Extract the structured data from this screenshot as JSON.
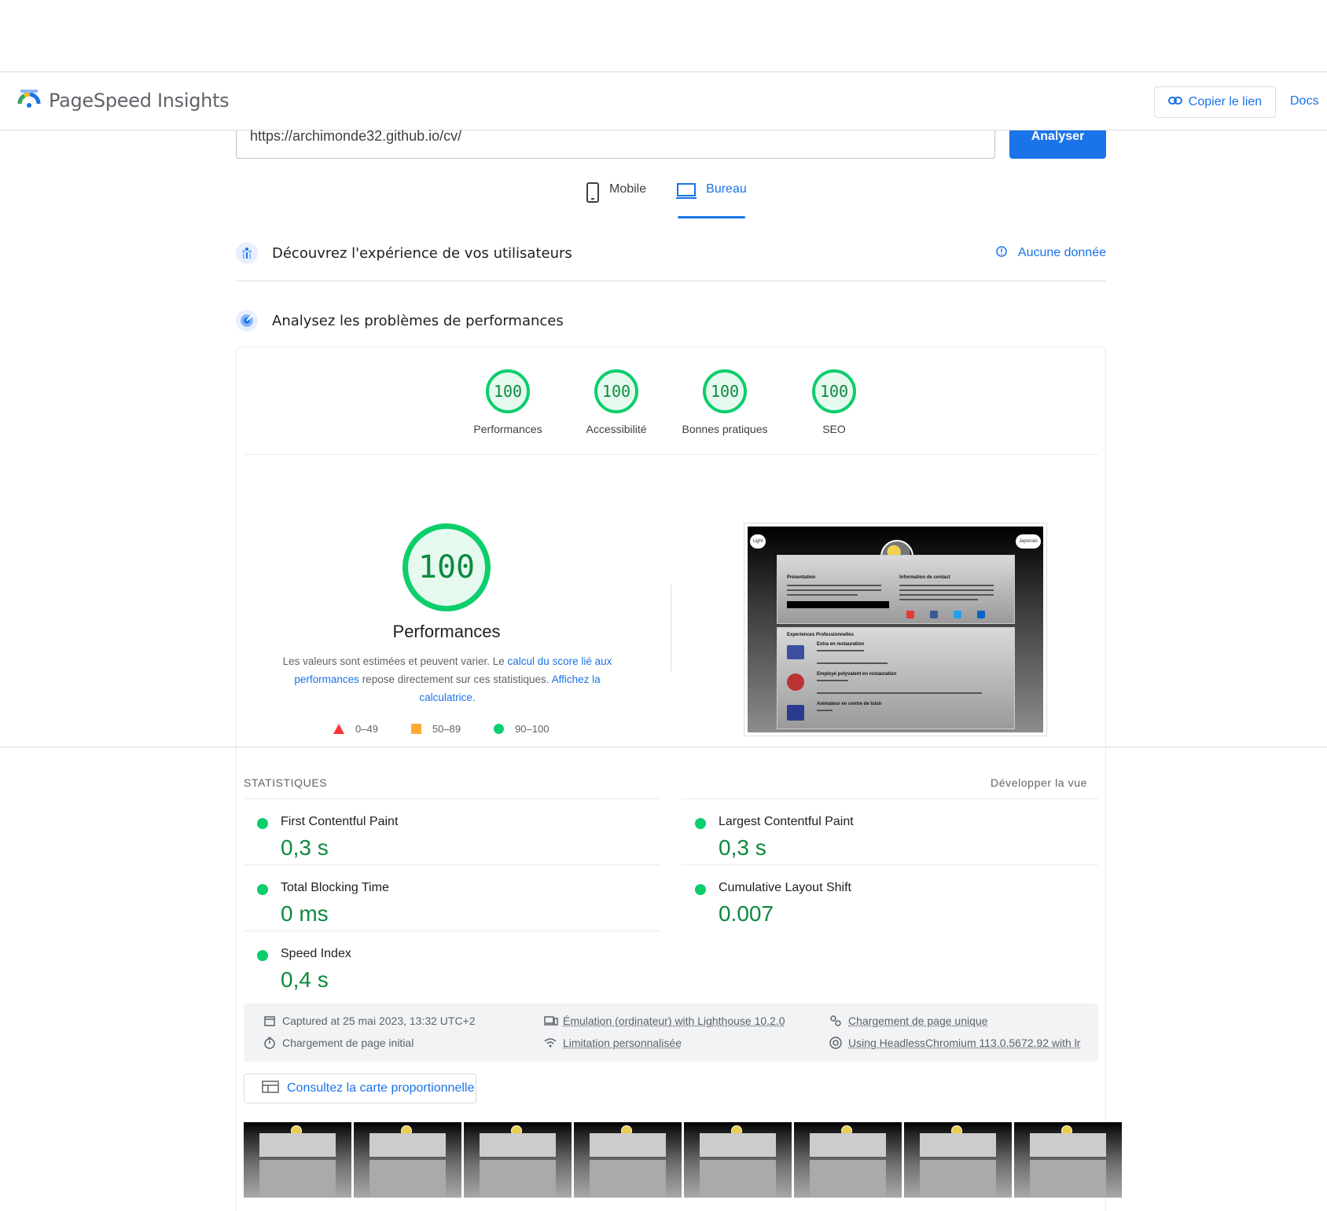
{
  "app": {
    "title": "PageSpeed Insights",
    "copy_link": "Copier le lien",
    "docs": "Docs"
  },
  "search": {
    "url": "https://archimonde32.github.io/cv/",
    "analyze": "Analyser"
  },
  "device_tabs": [
    {
      "label": "Mobile",
      "icon": "phone-icon",
      "active": false
    },
    {
      "label": "Bureau",
      "icon": "laptop-icon",
      "active": true
    }
  ],
  "field_section": {
    "title": "Découvrez l'expérience de vos utilisateurs",
    "no_data": "Aucune donnée"
  },
  "lab_section": {
    "title": "Analysez les problèmes de performances"
  },
  "scores": [
    {
      "label": "Performances",
      "value": "100"
    },
    {
      "label": "Accessibilité",
      "value": "100"
    },
    {
      "label": "Bonnes pratiques",
      "value": "100"
    },
    {
      "label": "SEO",
      "value": "100"
    }
  ],
  "main_score": {
    "value": "100",
    "title": "Performances",
    "desc_1": "Les valeurs sont estimées et peuvent varier. Le ",
    "link_1": "calcul du score lié aux performances",
    "desc_2": " repose directement sur ces statistiques. ",
    "link_2": "Affichez la calculatrice.",
    "legend": [
      {
        "range": "0–49",
        "shape": "triangle",
        "color": "#ff3333"
      },
      {
        "range": "50–89",
        "shape": "square",
        "color": "#ffaa33"
      },
      {
        "range": "90–100",
        "shape": "circle",
        "color": "#0cce6b"
      }
    ]
  },
  "screenshot": {
    "left_pill": "Light",
    "right_pill": "Japonais",
    "panel1_left": "Présentation",
    "panel1_right": "Information de contact",
    "button": "Telecharger mon CV",
    "panel2_title": "Experiences Professionnelles",
    "job1": "Extra en restauration",
    "job2": "Employé polyvalent en restauration",
    "job3": "Animateur en centre de loisir"
  },
  "stats": {
    "header": "STATISTIQUES",
    "expand": "Développer la vue",
    "metrics": [
      {
        "name": "First Contentful Paint",
        "value": "0,3 s"
      },
      {
        "name": "Largest Contentful Paint",
        "value": "0,3 s"
      },
      {
        "name": "Total Blocking Time",
        "value": "0 ms"
      },
      {
        "name": "Cumulative Layout Shift",
        "value": "0.007"
      },
      {
        "name": "Speed Index",
        "value": "0,4 s"
      }
    ]
  },
  "run_info": {
    "captured": "Captured at 25 mai 2023, 13:32 UTC+2",
    "initial_load": "Chargement de page initial",
    "emulation": "Émulation (ordinateur) with Lighthouse 10.2.0",
    "throttling": "Limitation personnalisée",
    "single_load": "Chargement de page unique",
    "browser": "Using HeadlessChromium 113.0.5672.92 with lr"
  },
  "treemap": {
    "label": "Consultez la carte proportionnelle"
  },
  "colors": {
    "accent": "#1a73e8",
    "pass": "#0cce6b",
    "pass_text": "#0c8a3e"
  }
}
